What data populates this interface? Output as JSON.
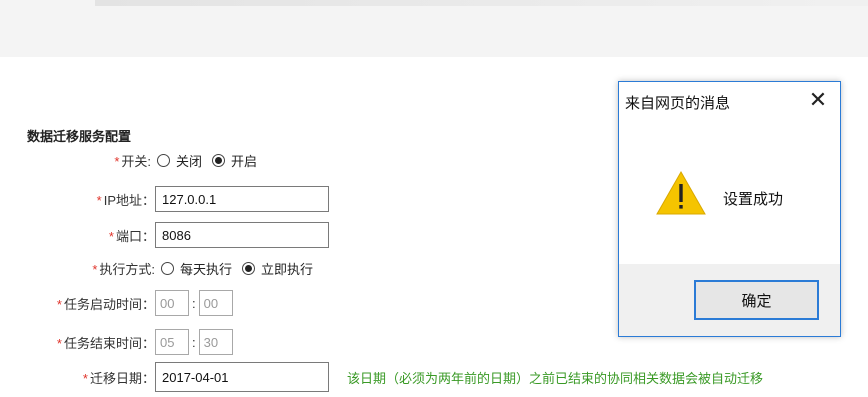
{
  "form": {
    "title": "数据迁移服务配置",
    "required_mark": "*",
    "switch": {
      "label": "开关:",
      "options": [
        "关闭",
        "开启"
      ],
      "selected": "开启"
    },
    "ip": {
      "label": "IP地址：",
      "value": "127.0.0.1"
    },
    "port": {
      "label": "端口：",
      "value": "8086"
    },
    "exec_mode": {
      "label": "执行方式:",
      "options": [
        "每天执行",
        "立即执行"
      ],
      "selected": "立即执行"
    },
    "start_time": {
      "label": "任务启动时间：",
      "hour": "00",
      "minute": "00"
    },
    "end_time": {
      "label": "任务结束时间：",
      "hour": "05",
      "minute": "30"
    },
    "migrate_date": {
      "label": "迁移日期：",
      "value": "2017-04-01",
      "hint": "该日期（必须为两年前的日期）之前已结束的协同相关数据会被自动迁移"
    },
    "time_separator": ":"
  },
  "dialog": {
    "title": "来自网页的消息",
    "close_symbol": "✕",
    "icon": "warning-icon",
    "message": "设置成功",
    "ok_label": "确定"
  },
  "colors": {
    "required": "#e0332a",
    "hint": "#3a9a26",
    "dialog_border": "#2b7bd6",
    "warning_fill": "#f5c400"
  }
}
